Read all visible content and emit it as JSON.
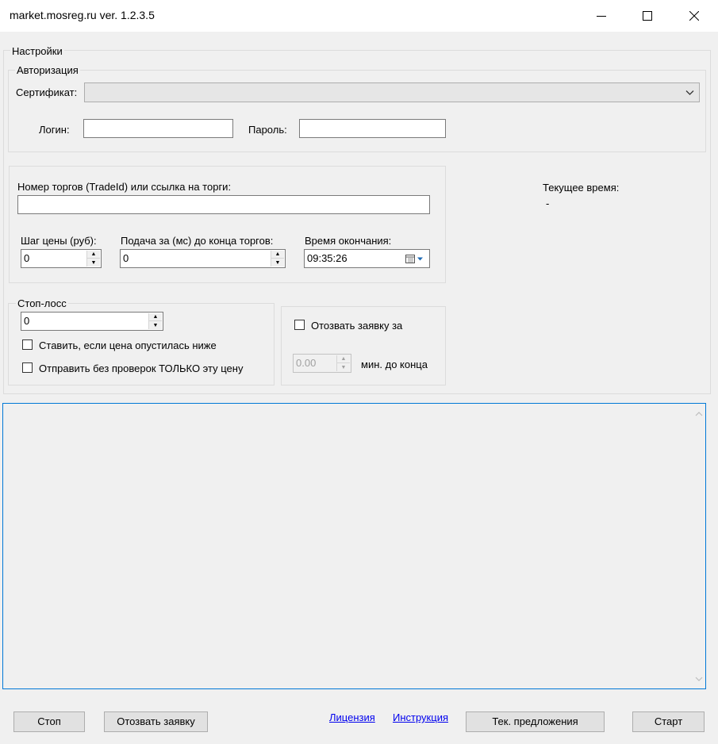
{
  "window": {
    "title": "market.mosreg.ru ver. 1.2.3.5",
    "minimize_icon": "minimize-icon",
    "maximize_icon": "maximize-icon",
    "close_icon": "close-icon"
  },
  "settings": {
    "legend": "Настройки",
    "auth": {
      "legend": "Авторизация",
      "certificate_label": "Сертификат:",
      "certificate_value": "",
      "login_label": "Логин:",
      "login_value": "",
      "password_label": "Пароль:",
      "password_value": ""
    },
    "trade": {
      "trade_id_label": "Номер торгов (TradeId) или ссылка на торги:",
      "trade_id_value": "",
      "price_step_label": "Шаг цены (руб):",
      "price_step_value": "0",
      "submit_before_label": "Подача за (мс) до конца торгов:",
      "submit_before_value": "0",
      "end_time_label": "Время окончания:",
      "end_time_value": "09:35:26"
    },
    "current_time": {
      "label": "Текущее время:",
      "value": "-"
    },
    "stop_loss": {
      "legend": "Стоп-лосс",
      "value": "0",
      "place_if_lower_label": "Ставить, если цена опустилась ниже",
      "place_if_lower_checked": false,
      "send_without_checks_label": "Отправить без проверок ТОЛЬКО эту цену",
      "send_without_checks_checked": false
    },
    "withdraw": {
      "checkbox_label": "Отозвать заявку за",
      "checked": false,
      "minutes_value": "0.00",
      "minutes_suffix": "мин. до конца"
    }
  },
  "log": {
    "text": ""
  },
  "footer": {
    "stop_button": "Стоп",
    "withdraw_button": "Отозвать заявку",
    "license_link": "Лицензия",
    "instruction_link": "Инструкция",
    "offers_button": "Тек. предложения",
    "start_button": "Старт"
  }
}
